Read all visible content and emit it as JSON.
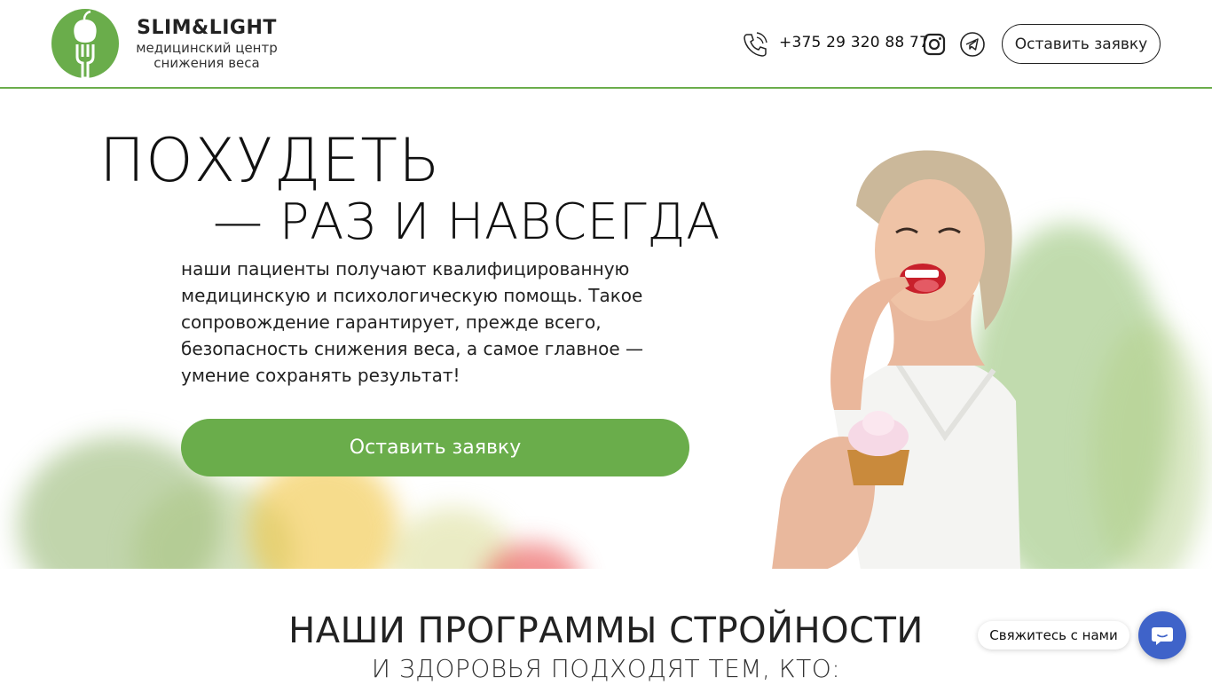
{
  "header": {
    "brand_name": "SLIM&LIGHT",
    "brand_sub_line1": "медицинский центр",
    "brand_sub_line2": "снижения веса",
    "phone": "+375 29 320 88 77",
    "cta_label": "Оставить заявку",
    "icons": [
      "logo-icon",
      "phone-icon",
      "instagram-icon",
      "telegram-icon"
    ]
  },
  "hero": {
    "title_line1": "ПОХУДЕТЬ",
    "title_line2": "— РАЗ И НАВСЕГДА",
    "description": "наши пациенты получают квалифицированную медицинскую и психологическую помощь. Такое сопровождение гарантирует, прежде всего, безопасность снижения веса, а самое главное — умение сохранять результат!",
    "cta_label": "Оставить заявку"
  },
  "programs": {
    "title": "НАШИ ПРОГРАММЫ СТРОЙНОСТИ",
    "subtitle": "И ЗДОРОВЬЯ ПОДХОДЯТ ТЕМ, КТО:"
  },
  "chat": {
    "label": "Свяжитесь с нами",
    "icon": "chat-bubble-icon"
  },
  "colors": {
    "accent": "#6aad4b",
    "chat": "#3f63c9",
    "text": "#111111"
  }
}
